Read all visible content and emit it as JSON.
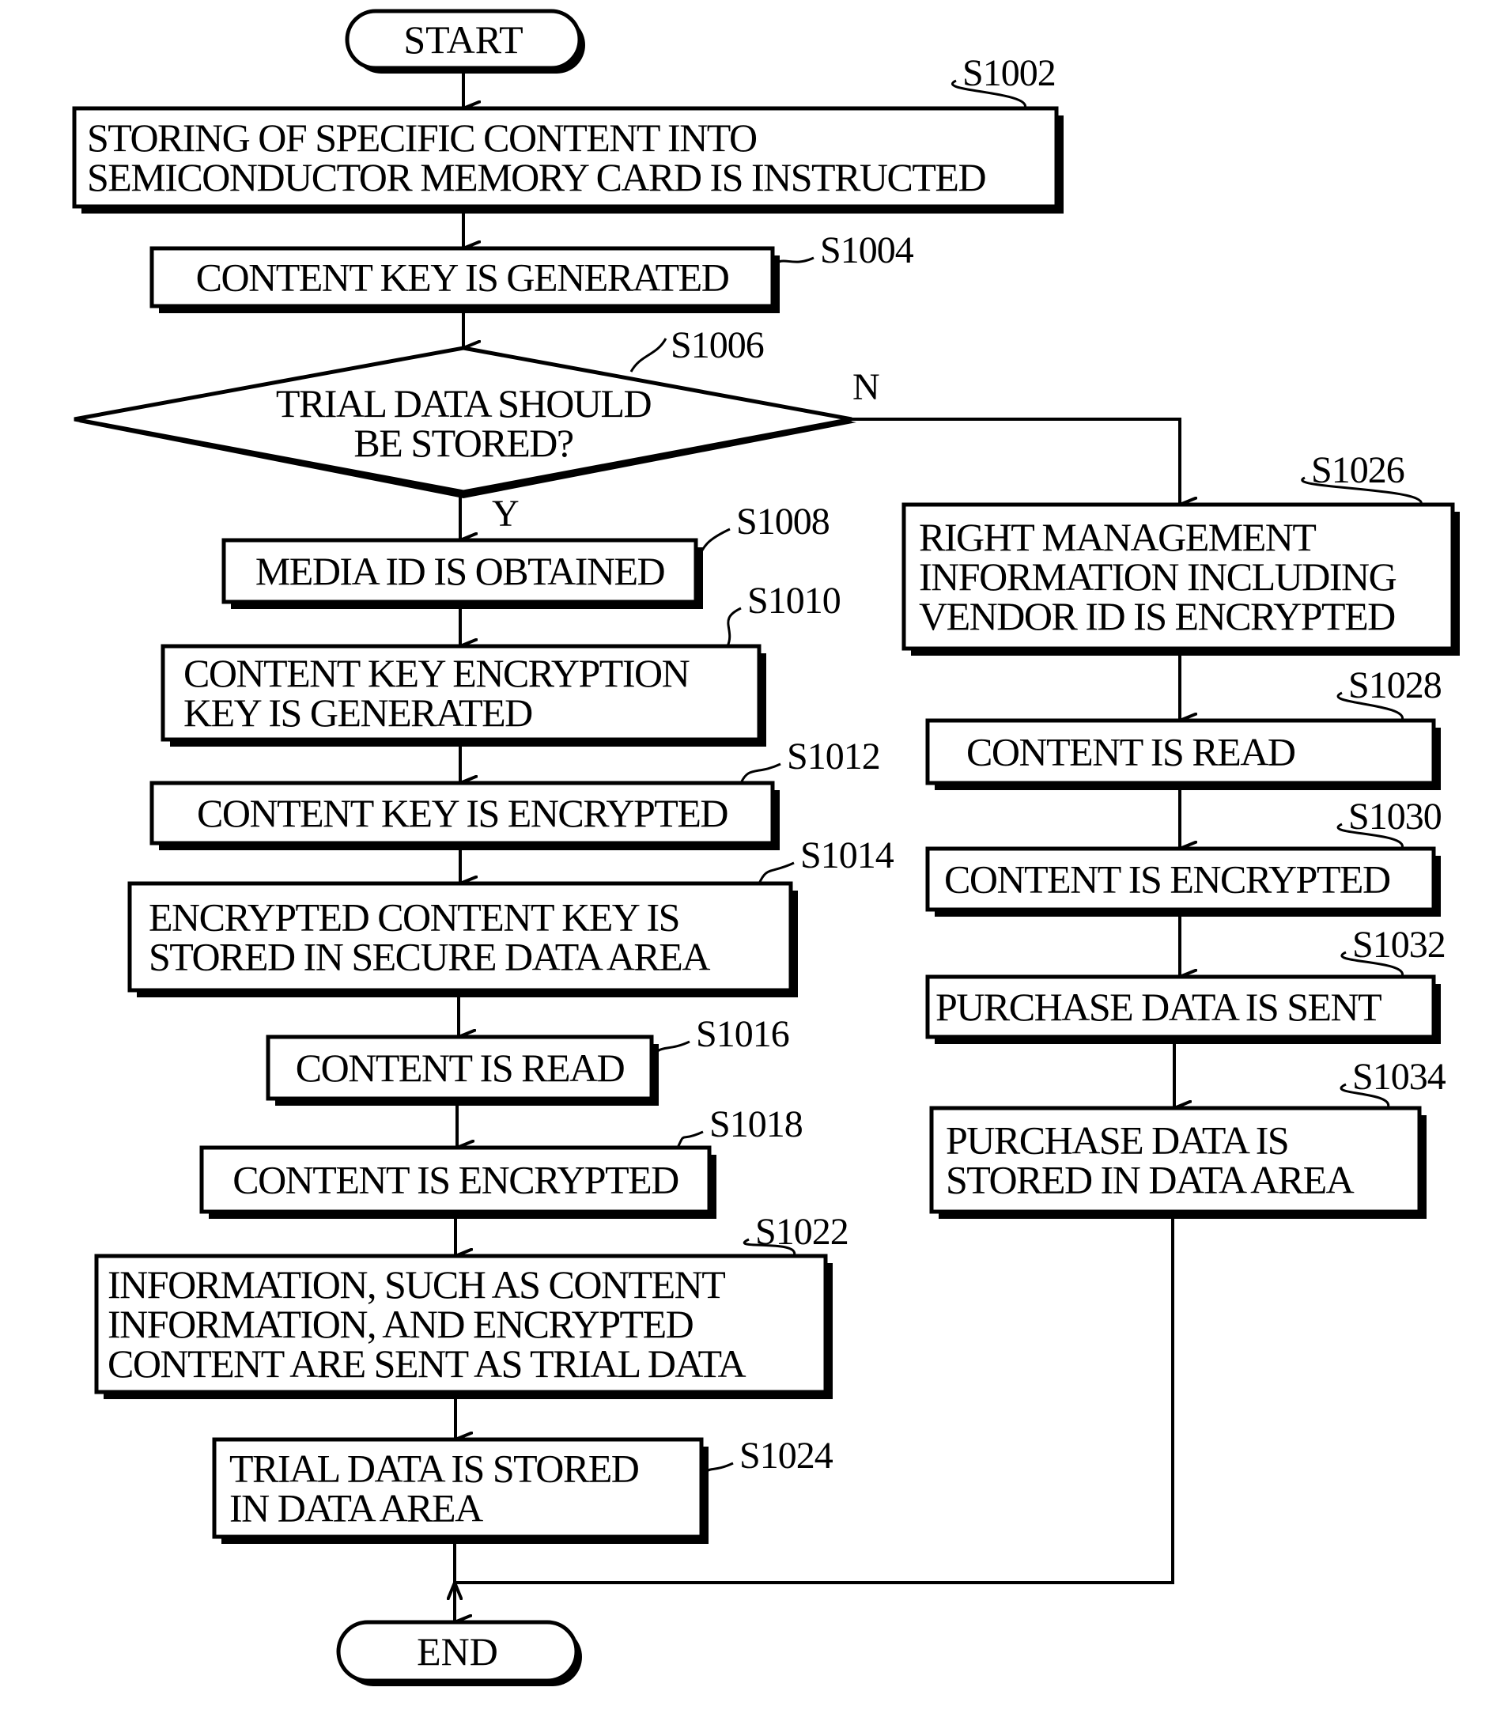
{
  "title": "Flowchart: storing specific content into semiconductor memory card",
  "terminals": {
    "start": "START",
    "end": "END"
  },
  "decision": {
    "id": "S1006",
    "lines": [
      "TRIAL DATA SHOULD",
      "BE STORED?"
    ],
    "yes_label": "Y",
    "no_label": "N"
  },
  "steps": {
    "s1002": {
      "id": "S1002",
      "lines": [
        "STORING OF SPECIFIC CONTENT INTO",
        "SEMICONDUCTOR MEMORY CARD IS INSTRUCTED"
      ]
    },
    "s1004": {
      "id": "S1004",
      "lines": [
        "CONTENT KEY IS GENERATED"
      ]
    },
    "s1008": {
      "id": "S1008",
      "lines": [
        "MEDIA ID IS OBTAINED"
      ]
    },
    "s1010": {
      "id": "S1010",
      "lines": [
        "CONTENT KEY ENCRYPTION",
        "KEY IS GENERATED"
      ]
    },
    "s1012": {
      "id": "S1012",
      "lines": [
        "CONTENT KEY IS ENCRYPTED"
      ]
    },
    "s1014": {
      "id": "S1014",
      "lines": [
        "ENCRYPTED CONTENT KEY IS",
        "STORED IN SECURE DATA AREA"
      ]
    },
    "s1016": {
      "id": "S1016",
      "lines": [
        "CONTENT IS READ"
      ]
    },
    "s1018": {
      "id": "S1018",
      "lines": [
        "CONTENT IS ENCRYPTED"
      ]
    },
    "s1022": {
      "id": "S1022",
      "lines": [
        "INFORMATION, SUCH AS CONTENT",
        "INFORMATION, AND ENCRYPTED",
        "CONTENT ARE SENT AS TRIAL DATA"
      ]
    },
    "s1024": {
      "id": "S1024",
      "lines": [
        "TRIAL DATA IS STORED",
        "IN DATA AREA"
      ]
    },
    "s1026": {
      "id": "S1026",
      "lines": [
        "RIGHT MANAGEMENT",
        "INFORMATION INCLUDING",
        "VENDOR ID IS ENCRYPTED"
      ]
    },
    "s1028": {
      "id": "S1028",
      "lines": [
        "CONTENT IS READ"
      ]
    },
    "s1030": {
      "id": "S1030",
      "lines": [
        "CONTENT IS ENCRYPTED"
      ]
    },
    "s1032": {
      "id": "S1032",
      "lines": [
        "PURCHASE DATA IS SENT"
      ]
    },
    "s1034": {
      "id": "S1034",
      "lines": [
        "PURCHASE DATA IS",
        "STORED IN DATA AREA"
      ]
    }
  }
}
